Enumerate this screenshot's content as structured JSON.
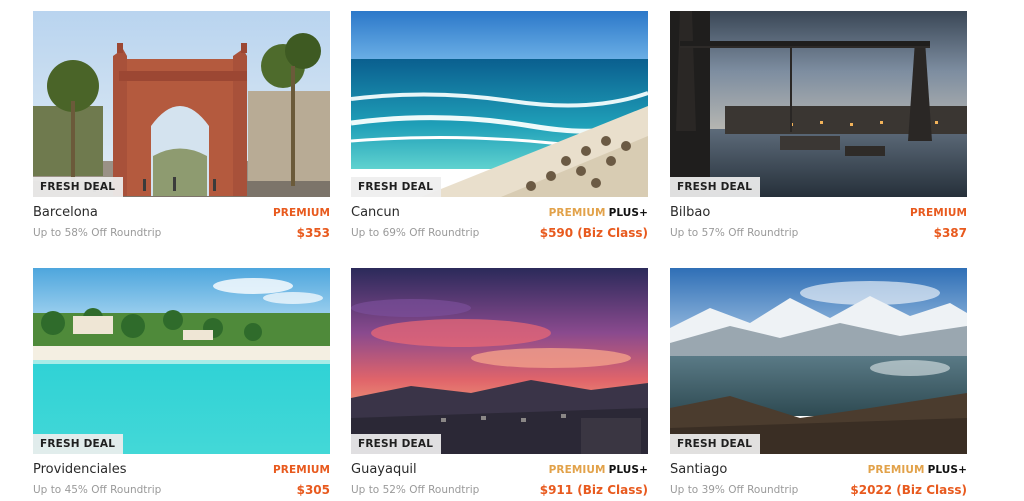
{
  "deals": [
    {
      "city": "Barcelona",
      "badge": "FRESH DEAL",
      "tier": "PREMIUM",
      "tier_plus": "",
      "subtitle": "Up to 58% Off Roundtrip",
      "price": "$353",
      "image": "barcelona-arc-photo"
    },
    {
      "city": "Cancun",
      "badge": "FRESH DEAL",
      "tier": "PREMIUM",
      "tier_plus": "PLUS+",
      "subtitle": "Up to 69% Off Roundtrip",
      "price": "$590 (Biz Class)",
      "image": "cancun-beach-photo"
    },
    {
      "city": "Bilbao",
      "badge": "FRESH DEAL",
      "tier": "PREMIUM",
      "tier_plus": "",
      "subtitle": "Up to 57% Off Roundtrip",
      "price": "$387",
      "image": "bilbao-bridge-photo"
    },
    {
      "city": "Providenciales",
      "badge": "FRESH DEAL",
      "tier": "PREMIUM",
      "tier_plus": "",
      "subtitle": "Up to 45% Off Roundtrip",
      "price": "$305",
      "image": "providenciales-beach-photo"
    },
    {
      "city": "Guayaquil",
      "badge": "FRESH DEAL",
      "tier": "PREMIUM",
      "tier_plus": "PLUS+",
      "subtitle": "Up to 52% Off Roundtrip",
      "price": "$911 (Biz Class)",
      "image": "guayaquil-sunset-photo"
    },
    {
      "city": "Santiago",
      "badge": "FRESH DEAL",
      "tier": "PREMIUM",
      "tier_plus": "PLUS+",
      "subtitle": "Up to 39% Off Roundtrip",
      "price": "$2022 (Biz Class)",
      "image": "santiago-lake-photo"
    }
  ],
  "colors": {
    "premium": "#e85a1e",
    "premium_plus": "#e2a24a",
    "plus": "#111111",
    "subtitle": "#9a9a9a"
  }
}
